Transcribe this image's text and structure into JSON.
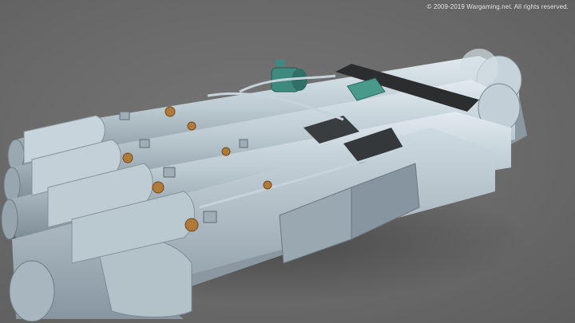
{
  "watermark": {
    "text": "© 2009-2019 Wargaming.net. All rights reserved."
  },
  "scene": {
    "subject": "quadruple-torpedo-tube-launcher",
    "tube_count": 4,
    "colors": {
      "background": "#6b6b6b",
      "tube_body": "#b9c7cf",
      "tube_shadow": "#7f8d96",
      "tube_highlight": "#dfe8ee",
      "brass_fitting": "#b07a3a",
      "teal_motor": "#3f8a7e",
      "dark_strap": "#2c2d2f"
    }
  }
}
